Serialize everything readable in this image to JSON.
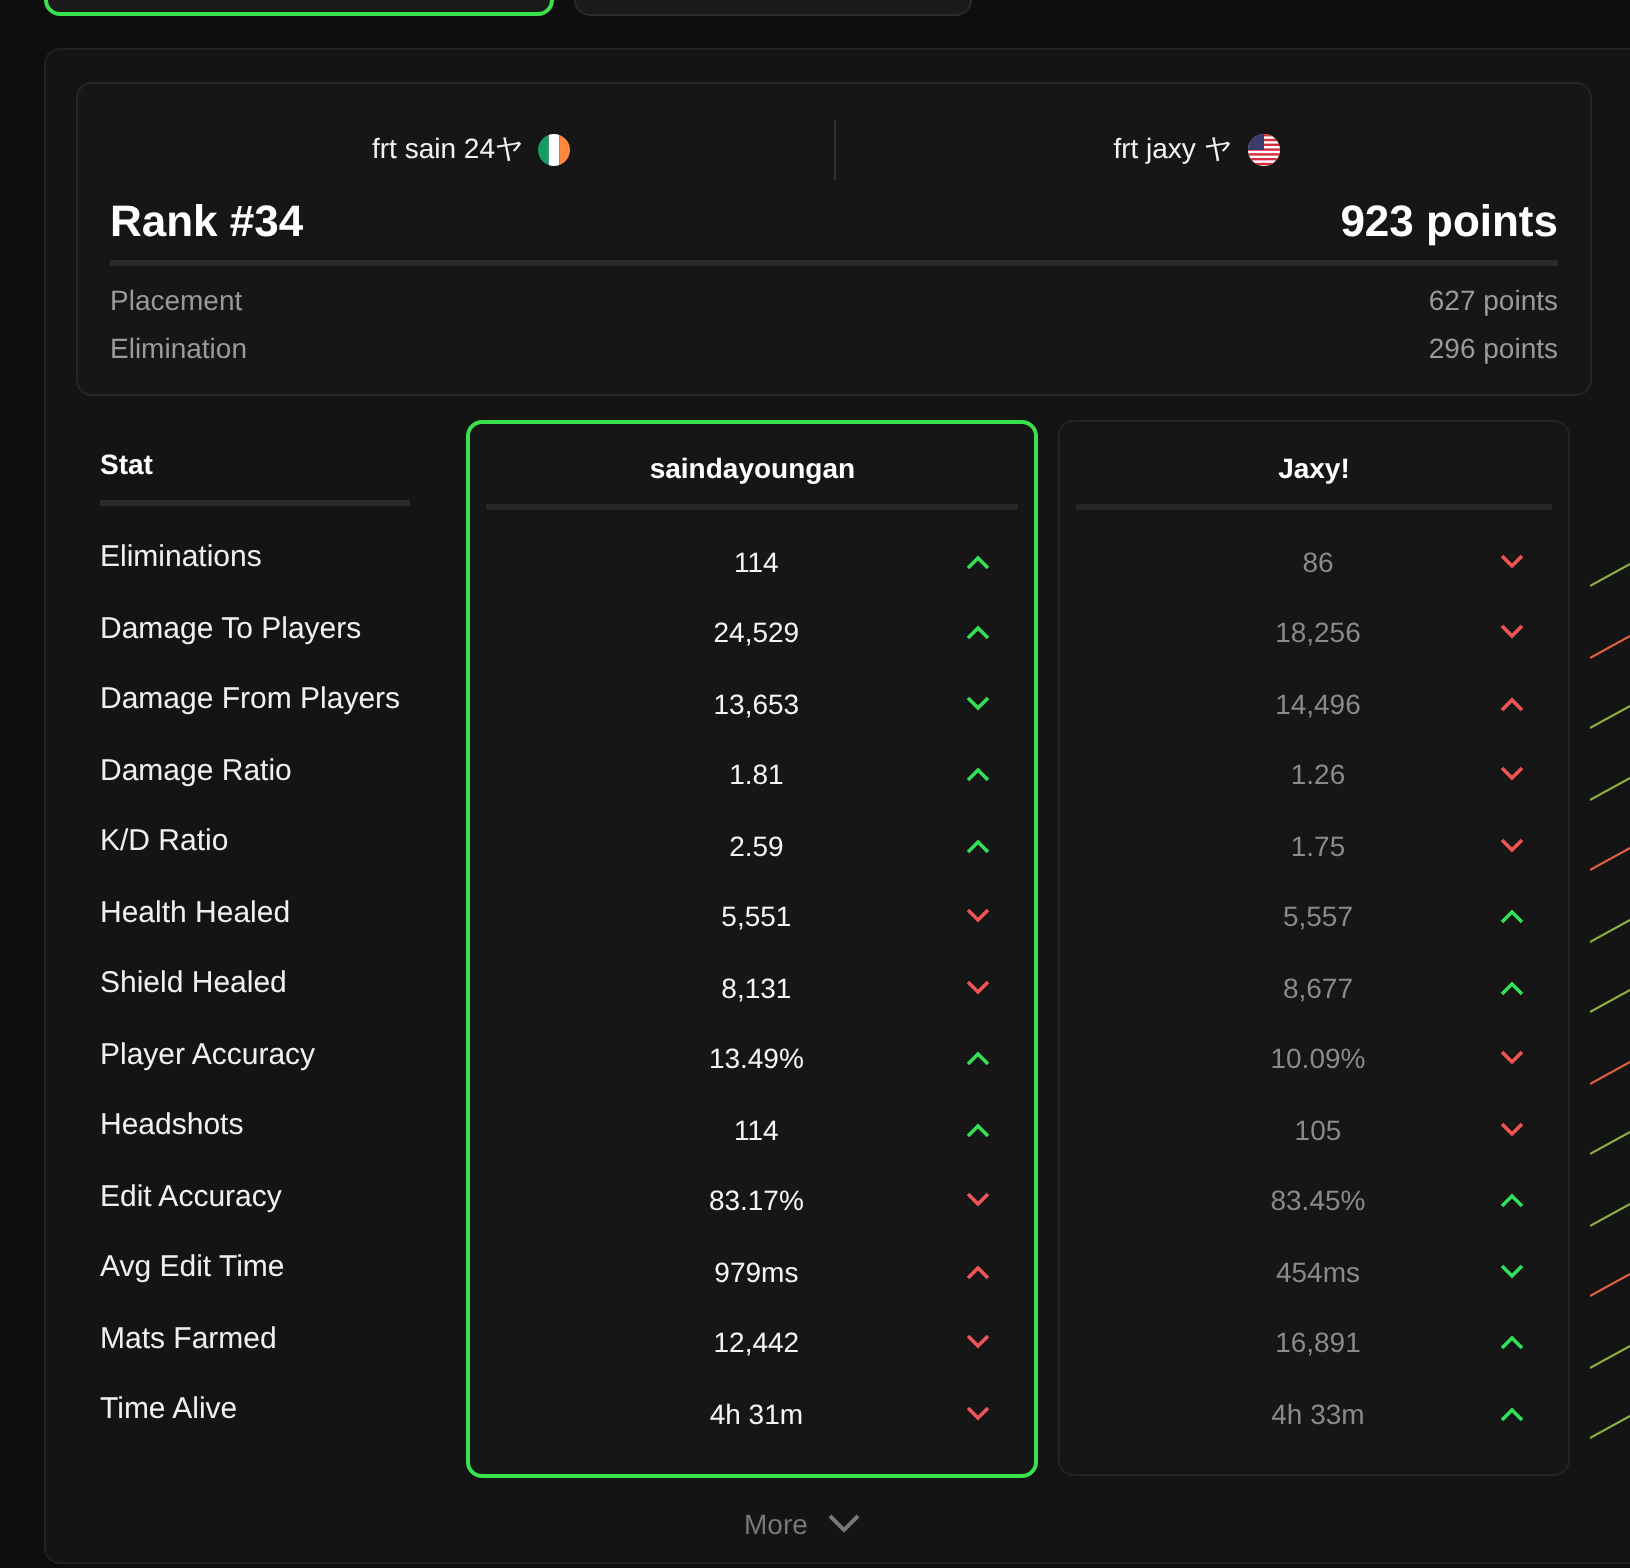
{
  "tabs": [
    {
      "selected": true
    },
    {
      "selected": false
    }
  ],
  "team": {
    "players": [
      {
        "name": "frt sain 24ヤ",
        "kind": "ireland"
      },
      {
        "name": "frt jaxy ヤ",
        "kind": "usa"
      }
    ],
    "rank": "Rank #34",
    "points": "923 points",
    "breakdown": [
      {
        "label": "Placement",
        "value": "627 points"
      },
      {
        "label": "Elimination",
        "value": "296 points"
      }
    ]
  },
  "table": {
    "stat_heading": "Stat",
    "stats": [
      "Eliminations",
      "Damage To Players",
      "Damage From Players",
      "Damage Ratio",
      "K/D Ratio",
      "Health Healed",
      "Shield Healed",
      "Player Accuracy",
      "Headshots",
      "Edit Accuracy",
      "Avg Edit Time",
      "Mats Farmed",
      "Time Alive"
    ],
    "players": [
      {
        "name": "saindayoungan",
        "selected": true,
        "cells": [
          {
            "value": "114",
            "kind": "up",
            "color": "#33e05a"
          },
          {
            "value": "24,529",
            "kind": "up",
            "color": "#33e05a"
          },
          {
            "value": "13,653",
            "kind": "down",
            "color": "#33e05a"
          },
          {
            "value": "1.81",
            "kind": "up",
            "color": "#33e05a"
          },
          {
            "value": "2.59",
            "kind": "up",
            "color": "#33e05a"
          },
          {
            "value": "5,551",
            "kind": "down",
            "color": "#f05454"
          },
          {
            "value": "8,131",
            "kind": "down",
            "color": "#f05454"
          },
          {
            "value": "13.49%",
            "kind": "up",
            "color": "#33e05a"
          },
          {
            "value": "114",
            "kind": "up",
            "color": "#33e05a"
          },
          {
            "value": "83.17%",
            "kind": "down",
            "color": "#f05454"
          },
          {
            "value": "979ms",
            "kind": "up",
            "color": "#f05454"
          },
          {
            "value": "12,442",
            "kind": "down",
            "color": "#f05454"
          },
          {
            "value": "4h 31m",
            "kind": "down",
            "color": "#f05454"
          }
        ]
      },
      {
        "name": "Jaxy!",
        "selected": false,
        "cells": [
          {
            "value": "86",
            "kind": "down",
            "color": "#f05454"
          },
          {
            "value": "18,256",
            "kind": "down",
            "color": "#f05454"
          },
          {
            "value": "14,496",
            "kind": "up",
            "color": "#f05454"
          },
          {
            "value": "1.26",
            "kind": "down",
            "color": "#f05454"
          },
          {
            "value": "1.75",
            "kind": "down",
            "color": "#f05454"
          },
          {
            "value": "5,557",
            "kind": "up",
            "color": "#33e05a"
          },
          {
            "value": "8,677",
            "kind": "up",
            "color": "#33e05a"
          },
          {
            "value": "10.09%",
            "kind": "down",
            "color": "#f05454"
          },
          {
            "value": "105",
            "kind": "down",
            "color": "#f05454"
          },
          {
            "value": "83.45%",
            "kind": "up",
            "color": "#33e05a"
          },
          {
            "value": "454ms",
            "kind": "down",
            "color": "#33e05a"
          },
          {
            "value": "16,891",
            "kind": "up",
            "color": "#33e05a"
          },
          {
            "value": "4h 33m",
            "kind": "up",
            "color": "#33e05a"
          }
        ]
      }
    ]
  },
  "more_button": "More"
}
